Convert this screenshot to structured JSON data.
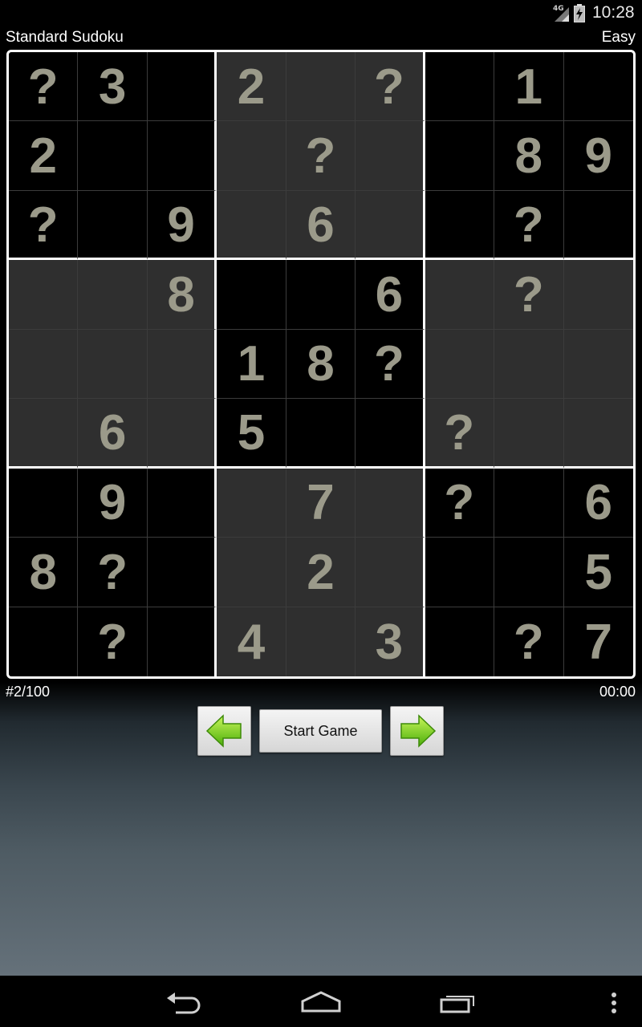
{
  "status_bar": {
    "network": "4G",
    "time": "10:28"
  },
  "header": {
    "title": "Standard Sudoku",
    "difficulty": "Easy"
  },
  "board": {
    "rows": [
      [
        "?",
        "3",
        "",
        "2",
        "",
        "?",
        "",
        "1",
        ""
      ],
      [
        "2",
        "",
        "",
        "",
        "?",
        "",
        "",
        "8",
        "9"
      ],
      [
        "?",
        "",
        "9",
        "",
        "6",
        "",
        "",
        "?",
        ""
      ],
      [
        "",
        "",
        "8",
        "",
        "",
        "6",
        "",
        "?",
        ""
      ],
      [
        "",
        "",
        "",
        "1",
        "8",
        "?",
        "",
        "",
        ""
      ],
      [
        "",
        "6",
        "",
        "5",
        "",
        "",
        "?",
        "",
        ""
      ],
      [
        "",
        "9",
        "",
        "",
        "7",
        "",
        "?",
        "",
        "6"
      ],
      [
        "8",
        "?",
        "",
        "",
        "2",
        "",
        "",
        "",
        "5"
      ],
      [
        "",
        "?",
        "",
        "4",
        "",
        "3",
        "",
        "?",
        "7"
      ]
    ]
  },
  "info": {
    "puzzle_number": "#2/100",
    "timer": "00:00"
  },
  "controls": {
    "prev_icon": "left-arrow-icon",
    "start_label": "Start Game",
    "next_icon": "right-arrow-icon"
  },
  "nav_bar": {
    "back_icon": "back-icon",
    "home_icon": "home-icon",
    "recents_icon": "recent-apps-icon",
    "menu_icon": "overflow-menu-icon"
  },
  "colors": {
    "digit": "#9b9a8a",
    "box_dark": "#000000",
    "box_light": "#2f2f2f",
    "arrow_green": "#7ed321"
  }
}
